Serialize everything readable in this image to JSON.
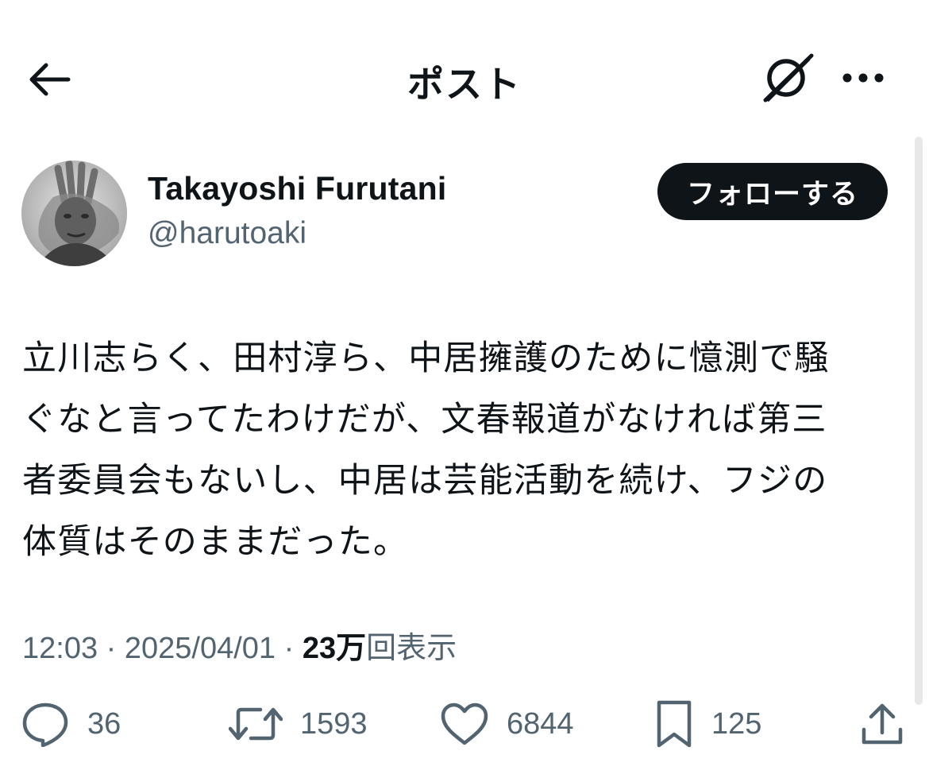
{
  "header": {
    "title": "ポスト",
    "back_icon": "arrow-left-icon",
    "grok_icon": "grok-icon",
    "more_icon": "more-horizontal-icon"
  },
  "author": {
    "display_name": "Takayoshi Furutani",
    "handle": "@harutoaki",
    "follow_label": "フォローする"
  },
  "tweet": {
    "lines": [
      "立川志らく、田村淳ら、中居擁護のために憶測で騒",
      "ぐなと言ってたわけだが、文春報道がなければ第三",
      "者委員会もないし、中居は芸能活動を続け、フジの",
      "体質はそのままだった。"
    ]
  },
  "meta": {
    "time": "12:03",
    "separator": "·",
    "date": "2025/04/01",
    "views_count": "23万",
    "views_label": "回表示"
  },
  "actions": {
    "reply_count": "36",
    "repost_count": "1593",
    "like_count": "6844",
    "bookmark_count": "125"
  },
  "colors": {
    "text_primary": "#0f1419",
    "text_secondary": "#536471",
    "follow_bg": "#0f1419",
    "follow_text": "#ffffff"
  }
}
